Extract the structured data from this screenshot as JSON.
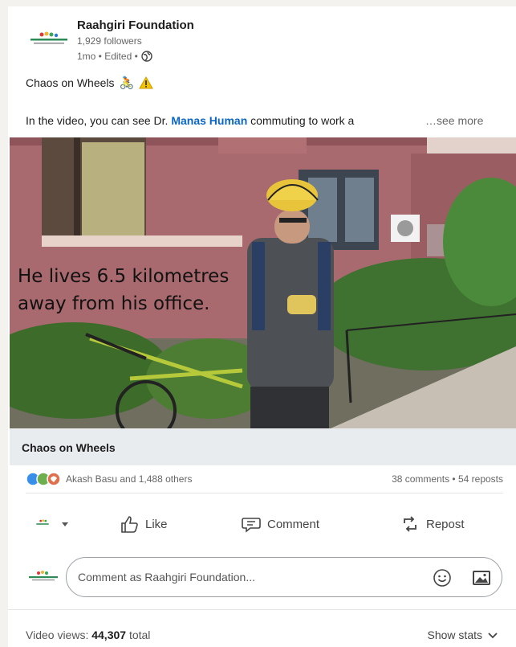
{
  "author": {
    "name": "Raahgiri Foundation",
    "followers": "1,929 followers",
    "meta": "1mo • Edited •"
  },
  "post": {
    "title": "Chaos on Wheels",
    "title_emoji": "🚴",
    "body_prefix": "In the video, you can see Dr. ",
    "mention": "Manas Human",
    "body_suffix": " commuting to work a",
    "see_more": "…see more"
  },
  "video": {
    "caption_line1": "He lives 6.5 kilometres",
    "caption_line2": "away from his office.",
    "title": "Chaos on Wheels"
  },
  "social": {
    "reactors": "Akash Basu and 1,488 others",
    "counts": "38 comments • 54 reposts"
  },
  "actions": {
    "like": "Like",
    "comment": "Comment",
    "repost": "Repost"
  },
  "comment_box": {
    "placeholder": "Comment as Raahgiri Foundation..."
  },
  "stats": {
    "views_label": "Video views: ",
    "views_value": "44,307",
    "views_suffix": " total",
    "show_stats": "Show stats"
  },
  "colors": {
    "link": "#0a66c2",
    "wall": "#a5676a"
  }
}
